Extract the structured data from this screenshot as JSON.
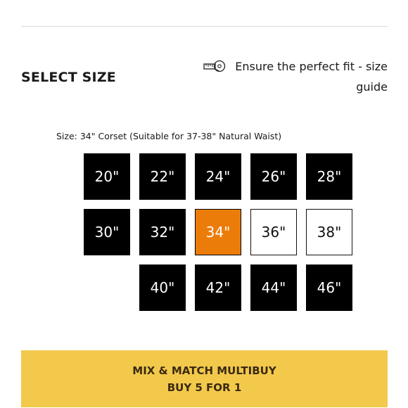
{
  "header": {
    "title": "SELECT SIZE",
    "guide_text": "Ensure the perfect fit - size guide",
    "guide_icon": "tape-measure-icon"
  },
  "size_description": "Size: 34\" Corset (Suitable for 37-38\" Natural Waist)",
  "sizes": [
    {
      "label": "20\"",
      "state": "available"
    },
    {
      "label": "22\"",
      "state": "available"
    },
    {
      "label": "24\"",
      "state": "available"
    },
    {
      "label": "26\"",
      "state": "available"
    },
    {
      "label": "28\"",
      "state": "available"
    },
    {
      "label": "30\"",
      "state": "available"
    },
    {
      "label": "32\"",
      "state": "available"
    },
    {
      "label": "34\"",
      "state": "selected"
    },
    {
      "label": "36\"",
      "state": "outlined"
    },
    {
      "label": "38\"",
      "state": "outlined"
    },
    {
      "label": "40\"",
      "state": "available"
    },
    {
      "label": "42\"",
      "state": "available"
    },
    {
      "label": "44\"",
      "state": "available"
    },
    {
      "label": "46\"",
      "state": "available"
    }
  ],
  "banner": {
    "line1": "MIX & MATCH MULTIBUY",
    "line2": "BUY 5 FOR 1"
  },
  "colors": {
    "selected": "#ec7c0a",
    "tile": "#000000",
    "banner": "#f3c94c"
  }
}
